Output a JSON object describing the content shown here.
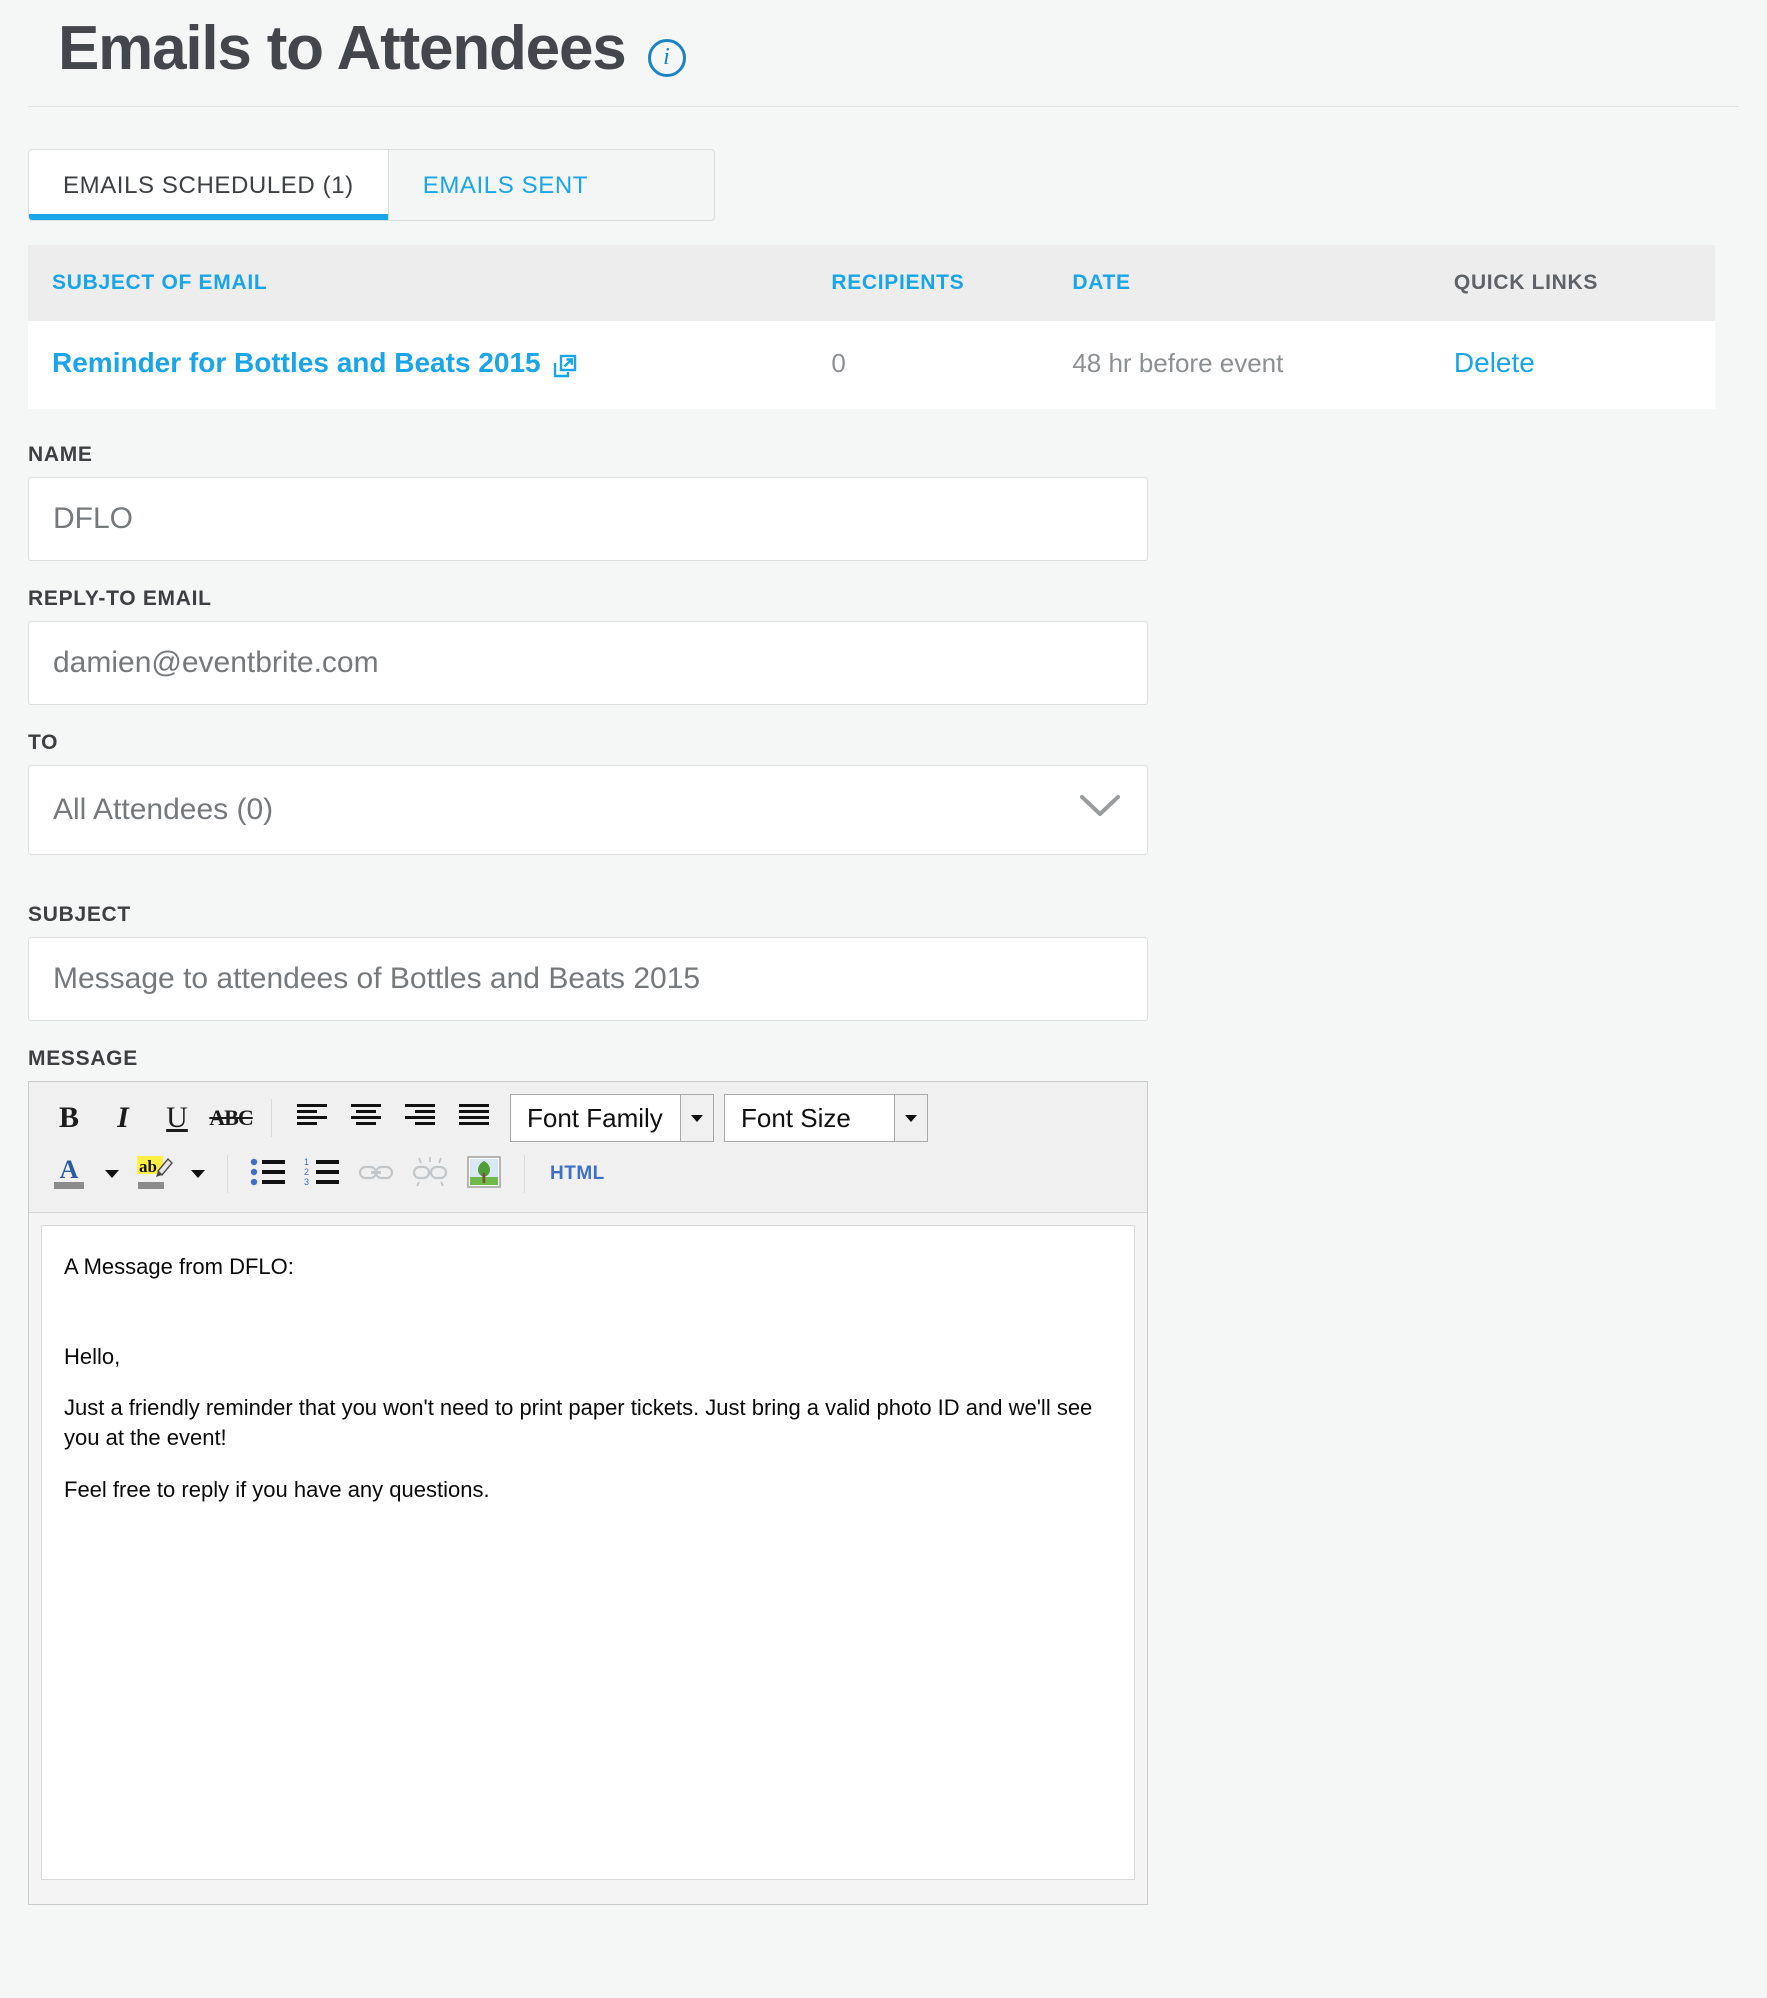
{
  "header": {
    "title": "Emails to Attendees",
    "info_icon": "info-icon",
    "info_glyph": "i"
  },
  "tabs": [
    {
      "label": "EMAILS SCHEDULED (1)",
      "active": true
    },
    {
      "label": "EMAILS SENT",
      "active": false
    }
  ],
  "table": {
    "headers": {
      "subject": "SUBJECT OF EMAIL",
      "recipients": "RECIPIENTS",
      "date": "DATE",
      "quick_links": "QUICK LINKS"
    },
    "rows": [
      {
        "subject": "Reminder for Bottles and Beats 2015",
        "subject_icon": "external-link-icon",
        "recipients": "0",
        "date": "48 hr before event",
        "quick_link": "Delete"
      }
    ]
  },
  "form": {
    "name": {
      "label": "NAME",
      "value": "DFLO",
      "placeholder": "DFLO"
    },
    "reply_to": {
      "label": "REPLY-TO EMAIL",
      "value": "damien@eventbrite.com",
      "placeholder": "damien@eventbrite.com"
    },
    "to": {
      "label": "TO",
      "value": "All Attendees (0)",
      "options": [
        "All Attendees (0)"
      ]
    },
    "subject": {
      "label": "SUBJECT",
      "value": "Message to attendees of Bottles and Beats 2015",
      "placeholder": "Message to attendees of Bottles and Beats 2015"
    },
    "message": {
      "label": "MESSAGE"
    }
  },
  "editor": {
    "toolbar": {
      "bold": "B",
      "italic": "I",
      "underline": "U",
      "strikethrough": "ABC",
      "align_left": "align-left-icon",
      "align_center": "align-center-icon",
      "align_right": "align-right-icon",
      "align_justify": "align-justify-icon",
      "font_family": "Font Family",
      "font_size": "Font Size",
      "text_color": "A",
      "highlight": "ab",
      "bullet_list": "unordered-list-icon",
      "numbered_list": "ordered-list-icon",
      "link": "link-icon",
      "unlink": "unlink-icon",
      "image": "image-icon",
      "html": "HTML"
    },
    "body": {
      "line1": "A Message from DFLO:",
      "line2": "Hello,",
      "line3": "Just a friendly reminder that you won't need to print paper tickets. Just bring a valid photo ID and we'll see you at the event!",
      "line4": "Feel free to reply if you have any questions."
    }
  },
  "colors": {
    "accent_blue": "#19a5e8",
    "info_blue": "#1a83c4",
    "text_dark": "#3d4043",
    "text_muted": "#9a9da0",
    "page_bg": "#f5f6f6",
    "table_head_bg": "#ededed"
  }
}
